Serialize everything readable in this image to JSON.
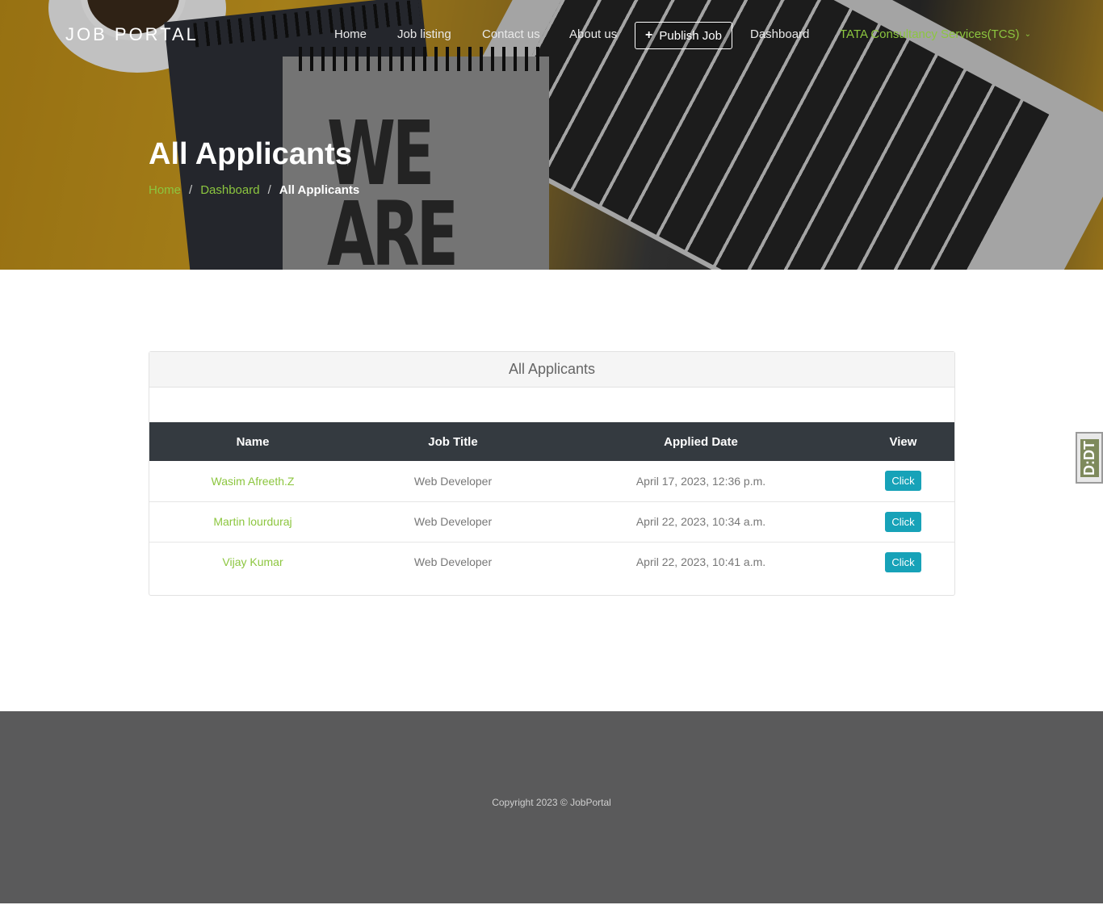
{
  "nav": {
    "brand": "JOB PORTAL",
    "links": [
      "Home",
      "Job listing",
      "Contact us",
      "About us"
    ],
    "publish_label": "Publish Job",
    "dashboard_label": "Dashboard",
    "company_label": "TATA Consultancy Services(TCS)"
  },
  "hero": {
    "title": "All Applicants",
    "breadcrumb": [
      "Home",
      "Dashboard",
      "All Applicants"
    ]
  },
  "card": {
    "title": "All Applicants",
    "columns": [
      "Name",
      "Job Title",
      "Applied Date",
      "View"
    ],
    "rows": [
      {
        "name": "Wasim Afreeth.Z",
        "job_title": "Web Developer",
        "applied_date": "April 17, 2023, 12:36 p.m.",
        "view": "Click"
      },
      {
        "name": "Martin lourduraj",
        "job_title": "Web Developer",
        "applied_date": "April 22, 2023, 10:34 a.m.",
        "view": "Click"
      },
      {
        "name": "Vijay Kumar",
        "job_title": "Web Developer",
        "applied_date": "April 22, 2023, 10:41 a.m.",
        "view": "Click"
      }
    ]
  },
  "side_widget": {
    "label": "D:DT"
  },
  "footer": {
    "copyright": "Copyright 2023 © JobPortal"
  },
  "colors": {
    "accent": "#8cc63f",
    "button": "#17a2b8",
    "table_header": "#343a40",
    "footer": "#5a5a5b"
  }
}
